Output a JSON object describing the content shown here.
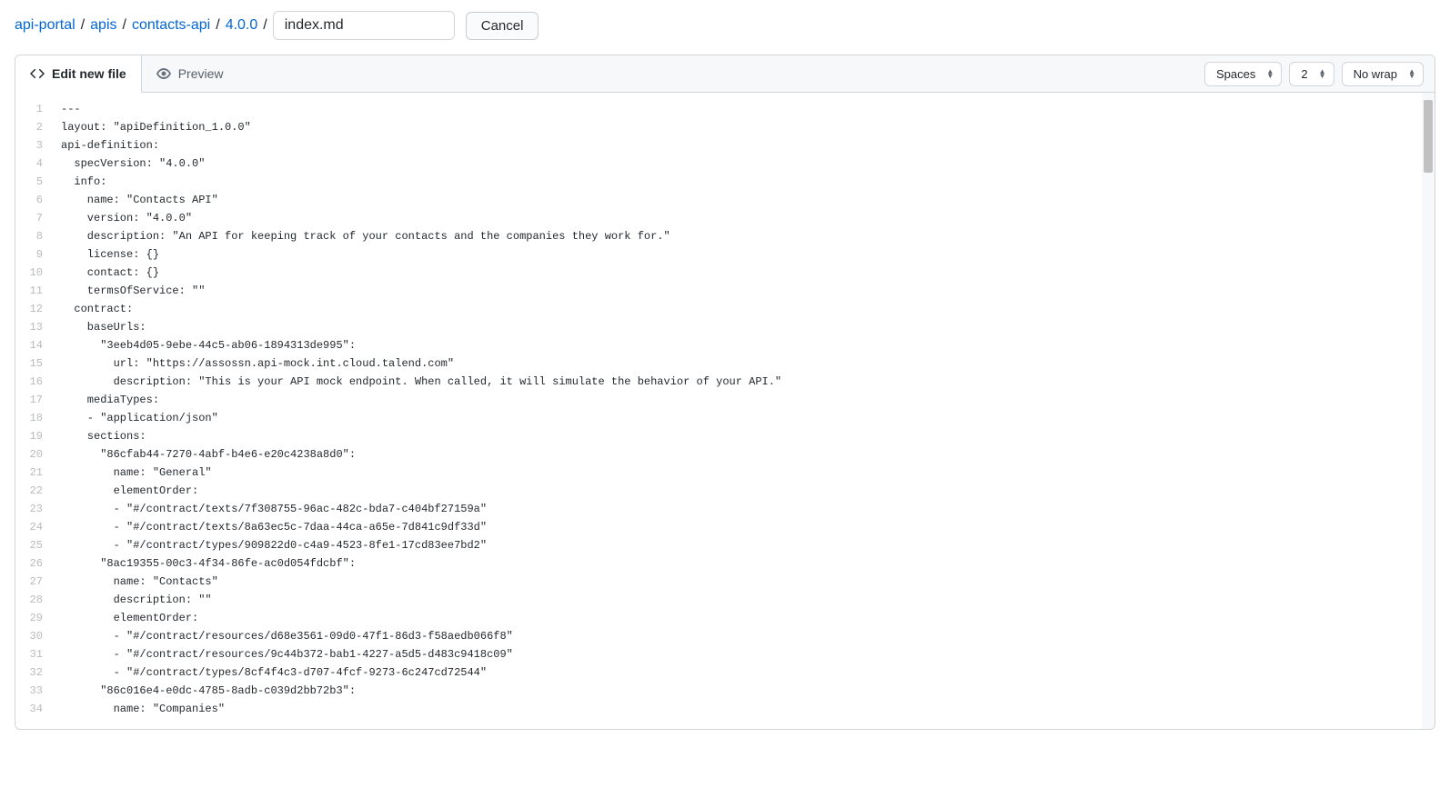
{
  "breadcrumb": {
    "parts": [
      "api-portal",
      "apis",
      "contacts-api",
      "4.0.0"
    ],
    "sep": "/"
  },
  "filename": {
    "value": "index.md"
  },
  "actions": {
    "cancel": "Cancel"
  },
  "tabs": {
    "edit": "Edit new file",
    "preview": "Preview"
  },
  "controls": {
    "indent_mode": "Spaces",
    "indent_size": "2",
    "wrap": "No wrap"
  },
  "code_lines": [
    "---",
    "layout: \"apiDefinition_1.0.0\"",
    "api-definition:",
    "  specVersion: \"4.0.0\"",
    "  info:",
    "    name: \"Contacts API\"",
    "    version: \"4.0.0\"",
    "    description: \"An API for keeping track of your contacts and the companies they work for.\"",
    "    license: {}",
    "    contact: {}",
    "    termsOfService: \"\"",
    "  contract:",
    "    baseUrls:",
    "      \"3eeb4d05-9ebe-44c5-ab06-1894313de995\":",
    "        url: \"https://assossn.api-mock.int.cloud.talend.com\"",
    "        description: \"This is your API mock endpoint. When called, it will simulate the behavior of your API.\"",
    "    mediaTypes:",
    "    - \"application/json\"",
    "    sections:",
    "      \"86cfab44-7270-4abf-b4e6-e20c4238a8d0\":",
    "        name: \"General\"",
    "        elementOrder:",
    "        - \"#/contract/texts/7f308755-96ac-482c-bda7-c404bf27159a\"",
    "        - \"#/contract/texts/8a63ec5c-7daa-44ca-a65e-7d841c9df33d\"",
    "        - \"#/contract/types/909822d0-c4a9-4523-8fe1-17cd83ee7bd2\"",
    "      \"8ac19355-00c3-4f34-86fe-ac0d054fdcbf\":",
    "        name: \"Contacts\"",
    "        description: \"\"",
    "        elementOrder:",
    "        - \"#/contract/resources/d68e3561-09d0-47f1-86d3-f58aedb066f8\"",
    "        - \"#/contract/resources/9c44b372-bab1-4227-a5d5-d483c9418c09\"",
    "        - \"#/contract/types/8cf4f4c3-d707-4fcf-9273-6c247cd72544\"",
    "      \"86c016e4-e0dc-4785-8adb-c039d2bb72b3\":",
    "        name: \"Companies\""
  ]
}
